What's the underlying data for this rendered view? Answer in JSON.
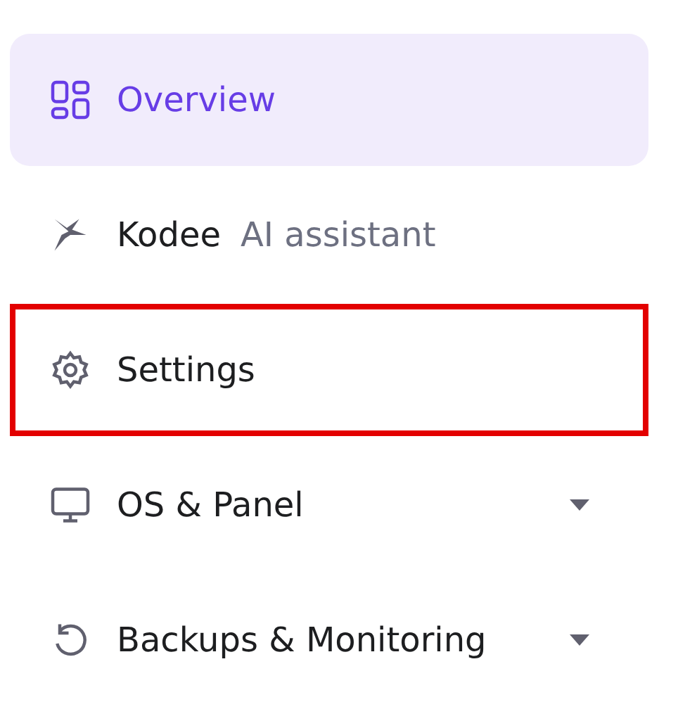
{
  "sidebar": {
    "items": [
      {
        "label": "Overview",
        "selected": true,
        "highlighted": false,
        "has_dropdown": false
      },
      {
        "label": "Kodee",
        "sublabel": "AI assistant",
        "selected": false,
        "highlighted": false,
        "has_dropdown": false
      },
      {
        "label": "Settings",
        "selected": false,
        "highlighted": true,
        "has_dropdown": false
      },
      {
        "label": "OS & Panel",
        "selected": false,
        "highlighted": false,
        "has_dropdown": true
      },
      {
        "label": "Backups & Monitoring",
        "selected": false,
        "highlighted": false,
        "has_dropdown": true
      }
    ]
  }
}
